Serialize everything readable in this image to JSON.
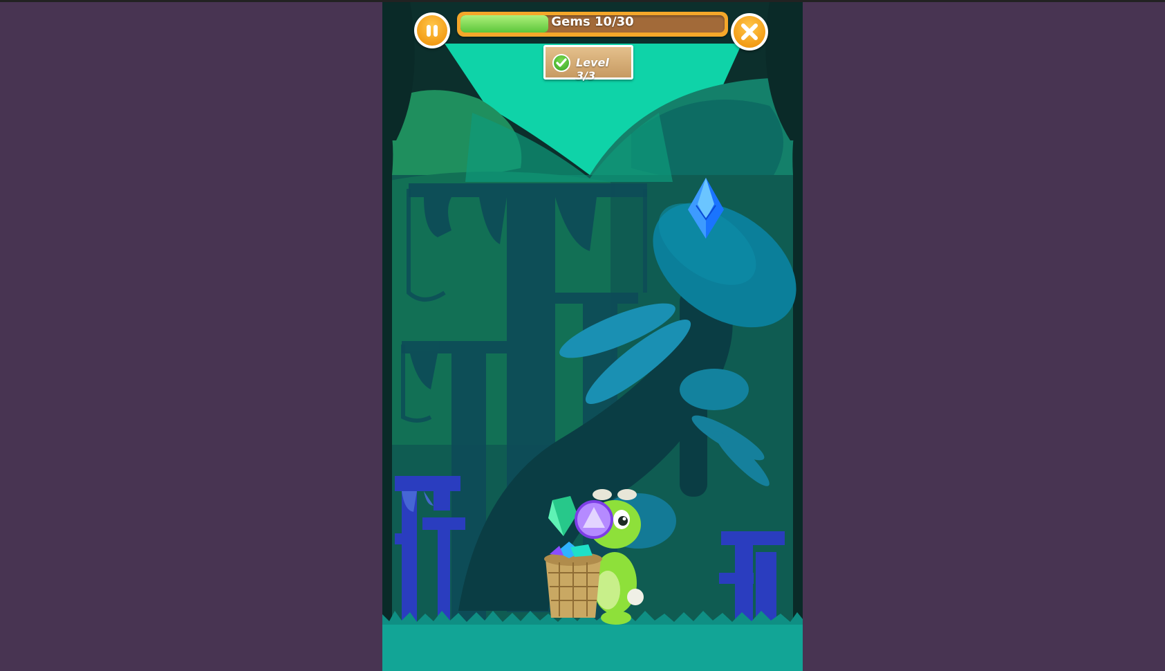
{
  "hud": {
    "gems_label": "Gems 10/30",
    "gems_collected": 10,
    "gems_total": 30,
    "level_label": "Level 3/3",
    "pause_icon": "pause-icon",
    "close_icon": "close-icon",
    "level_icon": "checkmark-icon"
  },
  "colors": {
    "background": "#483452",
    "button_orange": "#f29a14",
    "progress_fill": "#5cc63b",
    "ground": "#12a596"
  }
}
